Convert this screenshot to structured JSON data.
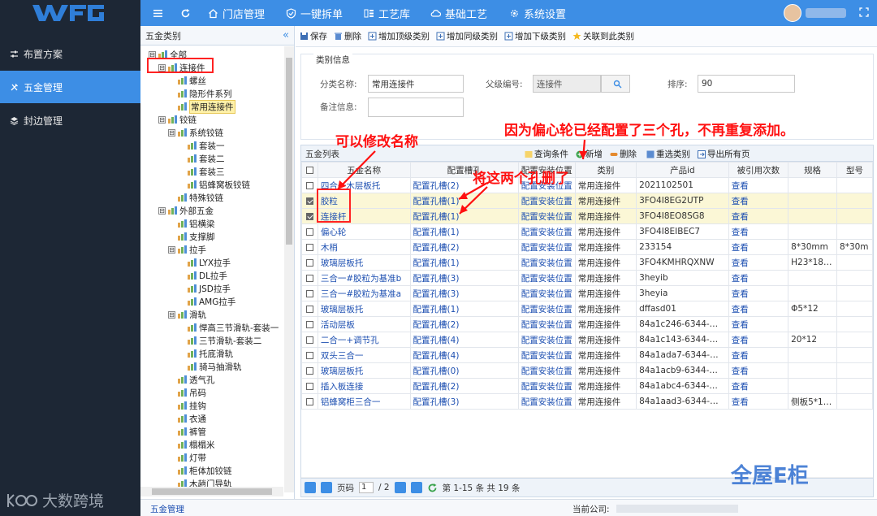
{
  "topnav": {
    "items": [
      {
        "label": "门店管理",
        "icon": "home-icon"
      },
      {
        "label": "一键拆单",
        "icon": "shield-check-icon"
      },
      {
        "label": "工艺库",
        "icon": "bars-icon"
      },
      {
        "label": "基础工艺",
        "icon": "cloud-icon"
      },
      {
        "label": "系统设置",
        "icon": "gear-icon"
      }
    ]
  },
  "sidebar": {
    "items": [
      {
        "label": "布置方案",
        "icon": "sliders-icon"
      },
      {
        "label": "五金管理",
        "icon": "tools-icon"
      },
      {
        "label": "封边管理",
        "icon": "stack-icon"
      }
    ],
    "watermark": "大数跨境"
  },
  "tree": {
    "title": "五金类别",
    "collapse": "«",
    "nodes": [
      {
        "label": "全部",
        "level": 0,
        "toggle": "⊟",
        "folder": true
      },
      {
        "label": "连接件",
        "level": 1,
        "toggle": "⊟",
        "folder": false
      },
      {
        "label": "螺丝",
        "level": 2
      },
      {
        "label": "隐形件系列",
        "level": 2
      },
      {
        "label": "常用连接件",
        "level": 2,
        "selected": true
      },
      {
        "label": "铰链",
        "level": 1,
        "toggle": "⊟"
      },
      {
        "label": "系统铰链",
        "level": 2,
        "toggle": "⊟"
      },
      {
        "label": "套装一",
        "level": 3
      },
      {
        "label": "套装二",
        "level": 3
      },
      {
        "label": "套装三",
        "level": 3
      },
      {
        "label": "铝蜂窝板铰链",
        "level": 3
      },
      {
        "label": "特殊铰链",
        "level": 2
      },
      {
        "label": "外部五金",
        "level": 1,
        "toggle": "⊟"
      },
      {
        "label": "铝横梁",
        "level": 2
      },
      {
        "label": "支撑脚",
        "level": 2
      },
      {
        "label": "拉手",
        "level": 2,
        "toggle": "⊟"
      },
      {
        "label": "LYX拉手",
        "level": 3
      },
      {
        "label": "DL拉手",
        "level": 3
      },
      {
        "label": "JSD拉手",
        "level": 3
      },
      {
        "label": "AMG拉手",
        "level": 3
      },
      {
        "label": "滑轨",
        "level": 2,
        "toggle": "⊟"
      },
      {
        "label": "悍高三节滑轨-套装一",
        "level": 3
      },
      {
        "label": "三节滑轨-套装二",
        "level": 3
      },
      {
        "label": "托底滑轨",
        "level": 3
      },
      {
        "label": "骑马抽滑轨",
        "level": 3
      },
      {
        "label": "透气孔",
        "level": 2
      },
      {
        "label": "吊码",
        "level": 2
      },
      {
        "label": "挂钩",
        "level": 2
      },
      {
        "label": "衣通",
        "level": 2
      },
      {
        "label": "裤管",
        "level": 2
      },
      {
        "label": "榻榻米",
        "level": 2
      },
      {
        "label": "灯带",
        "level": 2
      },
      {
        "label": "柜体加铰链",
        "level": 2
      },
      {
        "label": "木趟门导轨",
        "level": 2
      }
    ]
  },
  "toolbar": {
    "save": "保存",
    "delete": "删除",
    "add_top": "增加顶级类别",
    "add_same": "增加同级类别",
    "add_child": "增加下级类别",
    "link": "关联到此类别"
  },
  "category_info": {
    "section_title": "类别信息",
    "name_label": "分类名称:",
    "name_value": "常用连接件",
    "parent_label": "父级编号:",
    "parent_value": "连接件",
    "order_label": "排序:",
    "order_value": "90",
    "remark_label": "备注信息:",
    "remark_value": ""
  },
  "grid": {
    "title": "五金列表",
    "actions": {
      "query": "查询条件",
      "add": "新增",
      "delete": "删除",
      "reselect": "重选类别",
      "export": "导出所有页"
    },
    "columns": [
      "",
      "五金名称",
      "配置槽孔",
      "配置安装位置",
      "类别",
      "产品id",
      "被引用次数",
      "规格",
      "型号"
    ],
    "rows": [
      {
        "checked": false,
        "name": "四合一木层板托",
        "slot": "配置孔槽(2)",
        "pos": "配置安装位置",
        "cat": "常用连接件",
        "pid": "2021102501",
        "ref": "查看",
        "spec": "",
        "model": ""
      },
      {
        "checked": true,
        "name": "胶粒",
        "slot": "配置孔槽(1)",
        "pos": "配置安装位置",
        "cat": "常用连接件",
        "pid": "3FO4I8EG2UTP",
        "ref": "查看",
        "spec": "",
        "model": ""
      },
      {
        "checked": true,
        "name": "连接杆",
        "slot": "配置孔槽(1)",
        "pos": "配置安装位置",
        "cat": "常用连接件",
        "pid": "3FO4I8EO8SG8",
        "ref": "查看",
        "spec": "",
        "model": ""
      },
      {
        "checked": false,
        "name": "偏心轮",
        "slot": "配置孔槽(1)",
        "pos": "配置安装位置",
        "cat": "常用连接件",
        "pid": "3FO4I8EIBEC7",
        "ref": "查看",
        "spec": "",
        "model": ""
      },
      {
        "checked": false,
        "name": "木梢",
        "slot": "配置孔槽(2)",
        "pos": "配置安装位置",
        "cat": "常用连接件",
        "pid": "233154",
        "ref": "查看",
        "spec": "8*30mm",
        "model": "8*30m"
      },
      {
        "checked": false,
        "name": "玻璃层板托",
        "slot": "配置孔槽(1)",
        "pos": "配置安装位置",
        "cat": "常用连接件",
        "pid": "3FO4KMHRQXNW",
        "ref": "查看",
        "spec": "H23*18…",
        "model": ""
      },
      {
        "checked": false,
        "name": "三合一#胶粒为基准b",
        "slot": "配置孔槽(3)",
        "pos": "配置安装位置",
        "cat": "常用连接件",
        "pid": "3heyib",
        "ref": "查看",
        "spec": "",
        "model": ""
      },
      {
        "checked": false,
        "name": "三合一#胶粒为基准a",
        "slot": "配置孔槽(3)",
        "pos": "配置安装位置",
        "cat": "常用连接件",
        "pid": "3heyia",
        "ref": "查看",
        "spec": "",
        "model": ""
      },
      {
        "checked": false,
        "name": "玻璃层板托",
        "slot": "配置孔槽(1)",
        "pos": "配置安装位置",
        "cat": "常用连接件",
        "pid": "dffasd01",
        "ref": "查看",
        "spec": "Φ5*12",
        "model": ""
      },
      {
        "checked": false,
        "name": "活动层板",
        "slot": "配置孔槽(2)",
        "pos": "配置安装位置",
        "cat": "常用连接件",
        "pid": "84a1c246-6344-…",
        "ref": "查看",
        "spec": "",
        "model": ""
      },
      {
        "checked": false,
        "name": "二合一+调节孔",
        "slot": "配置孔槽(4)",
        "pos": "配置安装位置",
        "cat": "常用连接件",
        "pid": "84a1c143-6344-…",
        "ref": "查看",
        "spec": "20*12",
        "model": ""
      },
      {
        "checked": false,
        "name": "双头三合一",
        "slot": "配置孔槽(4)",
        "pos": "配置安装位置",
        "cat": "常用连接件",
        "pid": "84a1ada7-6344-…",
        "ref": "查看",
        "spec": "",
        "model": ""
      },
      {
        "checked": false,
        "name": "玻璃层板托",
        "slot": "配置孔槽(0)",
        "pos": "配置安装位置",
        "cat": "常用连接件",
        "pid": "84a1acb9-6344-…",
        "ref": "查看",
        "spec": "",
        "model": ""
      },
      {
        "checked": false,
        "name": "插入板连接",
        "slot": "配置孔槽(2)",
        "pos": "配置安装位置",
        "cat": "常用连接件",
        "pid": "84a1abc4-6344-…",
        "ref": "查看",
        "spec": "",
        "model": ""
      },
      {
        "checked": false,
        "name": "铝蜂窝柜三合一",
        "slot": "配置孔槽(3)",
        "pos": "配置安装位置",
        "cat": "常用连接件",
        "pid": "84a1aad3-6344-…",
        "ref": "查看",
        "spec": "侧板5*1…",
        "model": ""
      }
    ]
  },
  "pager": {
    "page_label": "页码",
    "page": "1",
    "total_pages": "/ 2",
    "summary": "第 1-15 条  共 19 条"
  },
  "statusbar": {
    "module": "五金管理",
    "company_label": "当前公司:"
  },
  "annotations": {
    "rename": "可以修改名称",
    "no_duplicate": "因为偏心轮已经配置了三个孔，不再重复添加。",
    "deleted": "将这两个孔删了"
  },
  "watermark2": "全屋E柜",
  "colors": {
    "accent": "#3d8ee5",
    "sidebar": "#1d2735",
    "annotation": "#ff1010"
  }
}
